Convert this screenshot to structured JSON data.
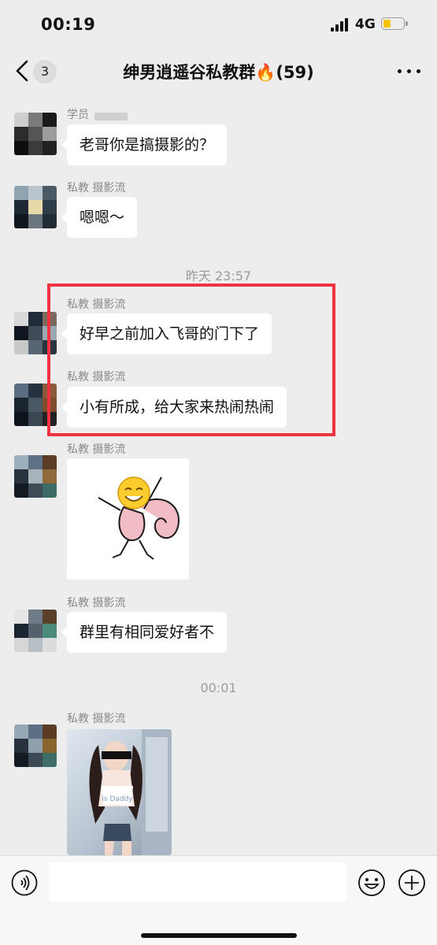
{
  "status_bar": {
    "time": "00:19",
    "network": "4G",
    "battery_level": 0.35
  },
  "header": {
    "unread_count": "3",
    "title": "绅男逍遥谷私教群🔥(59)"
  },
  "messages": [
    {
      "sender": "学员",
      "text": "老哥你是搞摄影的？"
    },
    {
      "sender": "私教 摄影流",
      "text": "嗯嗯～"
    },
    {
      "timestamp": "昨天 23:57"
    },
    {
      "sender": "私教 摄影流",
      "text": "好早之前加入飞哥的门下了"
    },
    {
      "sender": "私教 摄影流",
      "text": "小有所成，给大家来热闹热闹"
    },
    {
      "sender": "私教 摄影流",
      "type": "sticker",
      "icon": "dancing-smiley-sticker"
    },
    {
      "sender": "私教 摄影流",
      "text": "群里有相同爱好者不"
    },
    {
      "timestamp": "00:01"
    },
    {
      "sender": "私教 摄影流",
      "type": "image",
      "overlay_text": "is Daddy"
    }
  ],
  "input_bar": {
    "placeholder": ""
  },
  "colors": {
    "highlight_border": "#ef3340",
    "background": "#ededed",
    "battery": "#f5c400"
  },
  "icons": {
    "voice": "voice-icon",
    "emoji": "emoji-icon",
    "plus": "plus-icon",
    "back": "back-arrow-icon",
    "more": "more-icon"
  }
}
